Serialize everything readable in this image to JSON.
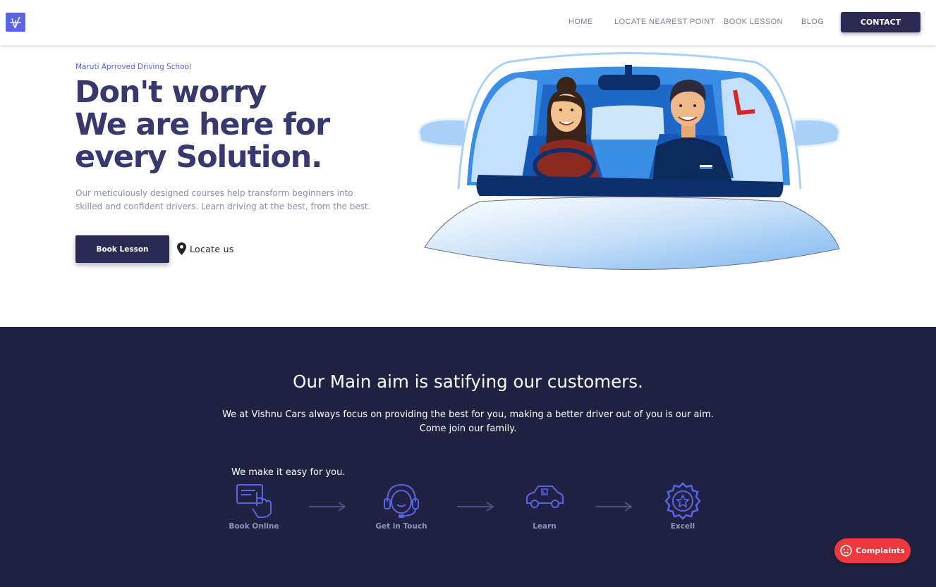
{
  "nav": {
    "logo_icon": "vishnu-logo-icon",
    "links": [
      "HOME",
      "LOCATE NEAREST POINT",
      "BOOK LESSON",
      "BLOG"
    ],
    "contact_label": "CONTACT"
  },
  "hero": {
    "eyebrow": "Maruti Aprroved Driving School",
    "headline": [
      "Don't worry",
      "We are here for",
      "every Solution."
    ],
    "description_line1": "Our meticulously designed courses help transform beginners into",
    "description_line2": "skilled and confident drivers. Learn driving at the best, from the best.",
    "book_label": "Book Lesson",
    "locate_label": "Locate us",
    "illustration": "car-driving-lesson-illustration"
  },
  "aim": {
    "title": "Our Main aim is satifying our customers.",
    "desc_line1": "We at Vishnu Cars always focus on providing the best for you, making a better driver out of you is our aim.",
    "desc_line2": "Come join our family.",
    "easy_label": "We make it easy for you.",
    "steps": [
      {
        "label": "Book Online",
        "icon": "book-online-icon"
      },
      {
        "label": "Get in Touch",
        "icon": "headset-support-icon"
      },
      {
        "label": "Learn",
        "icon": "learner-car-icon"
      },
      {
        "label": "Excell",
        "icon": "award-badge-icon"
      }
    ]
  },
  "complaints_label": "Complaints",
  "colors": {
    "brand": "#5a64e8",
    "navy": "#2a2a55",
    "headline": "#36386e",
    "dark_bg": "#212241",
    "complaints": "#ee3a3f"
  }
}
